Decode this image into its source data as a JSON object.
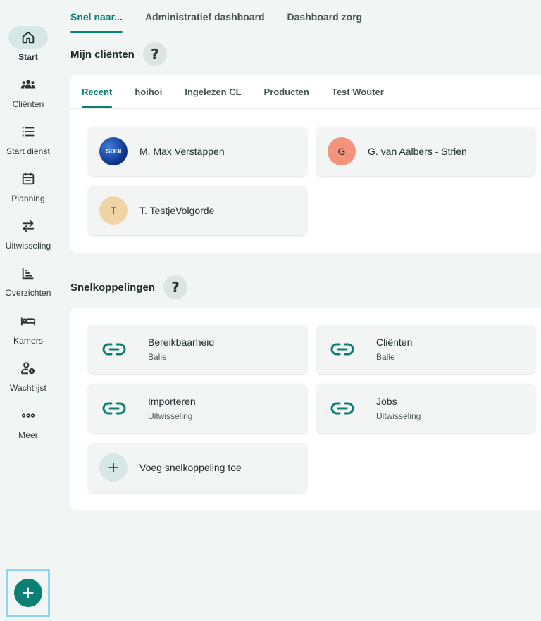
{
  "sidebar": {
    "items": [
      {
        "label": "Start",
        "icon": "home-icon",
        "active": true
      },
      {
        "label": "Cliënten",
        "icon": "group-icon"
      },
      {
        "label": "Start dienst",
        "icon": "list-icon"
      },
      {
        "label": "Planning",
        "icon": "calendar-icon"
      },
      {
        "label": "Uitwisseling",
        "icon": "swap-icon"
      },
      {
        "label": "Overzichten",
        "icon": "chart-icon"
      },
      {
        "label": "Kamers",
        "icon": "bed-icon"
      },
      {
        "label": "Wachtlijst",
        "icon": "person-clock-icon"
      },
      {
        "label": "Meer",
        "icon": "more-icon"
      }
    ],
    "fab_icon": "plus-icon"
  },
  "top_tabs": [
    {
      "label": "Snel naar...",
      "active": true
    },
    {
      "label": "Administratief dashboard"
    },
    {
      "label": "Dashboard zorg"
    }
  ],
  "clients_section": {
    "title": "Mijn cliënten",
    "help": "?",
    "tabs": [
      {
        "label": "Recent",
        "active": true
      },
      {
        "label": "hoihoi"
      },
      {
        "label": "Ingelezen CL"
      },
      {
        "label": "Producten"
      },
      {
        "label": "Test Wouter"
      }
    ],
    "clients": [
      {
        "name": "M. Max Verstappen",
        "avatar_text": "SDBI",
        "avatar_type": "logo"
      },
      {
        "name": "G. van Aalbers - Strien",
        "avatar_text": "G",
        "avatar_color": "#f4937c"
      },
      {
        "name": "T. TestjeVolgorde",
        "avatar_text": "T",
        "avatar_color": "#f1d4a6"
      }
    ]
  },
  "shortcuts_section": {
    "title": "Snelkoppelingen",
    "help": "?",
    "links": [
      {
        "title": "Bereikbaarheid",
        "subtitle": "Balie"
      },
      {
        "title": "Cliënten",
        "subtitle": "Balie"
      },
      {
        "title": "Importeren",
        "subtitle": "Uitwisseling"
      },
      {
        "title": "Jobs",
        "subtitle": "Uitwisseling"
      }
    ],
    "add_label": "Voeg snelkoppeling toe"
  },
  "colors": {
    "accent": "#0a7f72",
    "background": "#f1f6f5",
    "active_pill": "#d5e8e5"
  }
}
